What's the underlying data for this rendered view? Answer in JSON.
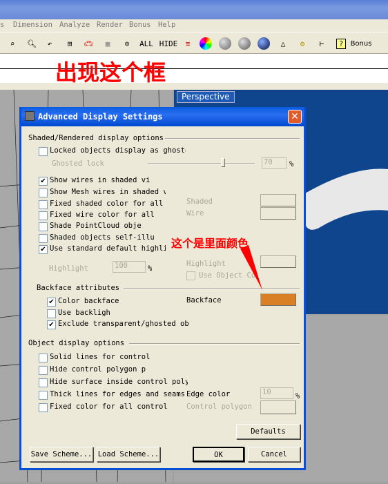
{
  "menu": [
    "s",
    "Dimension",
    "Analyze",
    "Render",
    "Bonus",
    "Help"
  ],
  "toolbar": {
    "all": "ALL",
    "hide": "HIDE",
    "bonus": "Bonus"
  },
  "annotations": {
    "top": "出现这个框",
    "color": "这个是里面颜色"
  },
  "viewport": {
    "perspective": "Perspective"
  },
  "dialog": {
    "title": "Advanced Display Settings",
    "shaded_section": "Shaded/Rendered display options",
    "locked": {
      "label": "Locked objects display as ghoste",
      "checked": false
    },
    "ghosted_lock": {
      "label": "Ghosted lock",
      "value": "70",
      "unit": "%",
      "slider_percent": 70
    },
    "shaded_options": [
      {
        "label": "Show wires in shaded vi",
        "checked": true
      },
      {
        "label": "Show Mesh wires in shaded vi",
        "checked": false
      },
      {
        "label": "Fixed shaded color for all",
        "checked": false
      },
      {
        "label": "Fixed wire color for all",
        "checked": false
      },
      {
        "label": "Shade PointCloud obje",
        "checked": false
      },
      {
        "label": "Shaded objects self-illu",
        "checked": false
      },
      {
        "label": "Use standard default highli",
        "checked": true
      }
    ],
    "highlight": {
      "label": "Highlight",
      "value": "100",
      "unit": "%"
    },
    "right": {
      "shaded": "Shaded",
      "wire": "Wire",
      "highlight": "Highlight",
      "use_object_color": "Use Object Co"
    },
    "backface_section": "Backface attributes",
    "backface_options": [
      {
        "label": "Color backface",
        "checked": true
      },
      {
        "label": "Use backligh",
        "checked": false
      },
      {
        "label": "Exclude transparent/ghosted ob",
        "checked": true
      }
    ],
    "backface": {
      "label": "Backface",
      "color": "#d98026"
    },
    "object_section": "Object display options",
    "object_options": [
      {
        "label": "Solid lines for control",
        "checked": false
      },
      {
        "label": "Hide control polygon p",
        "checked": false
      },
      {
        "label": "Hide surface inside control polyg",
        "checked": false
      },
      {
        "label": "Thick lines for edges and seams",
        "checked": false
      },
      {
        "label": "Fixed color for all control",
        "checked": false
      }
    ],
    "edge_color": {
      "label": "Edge color",
      "value": "10",
      "unit": "%"
    },
    "control_polygon": "Control polygon",
    "buttons": {
      "defaults": "Defaults",
      "save": "Save Scheme...",
      "load": "Load Scheme...",
      "ok": "OK",
      "cancel": "Cancel"
    }
  }
}
